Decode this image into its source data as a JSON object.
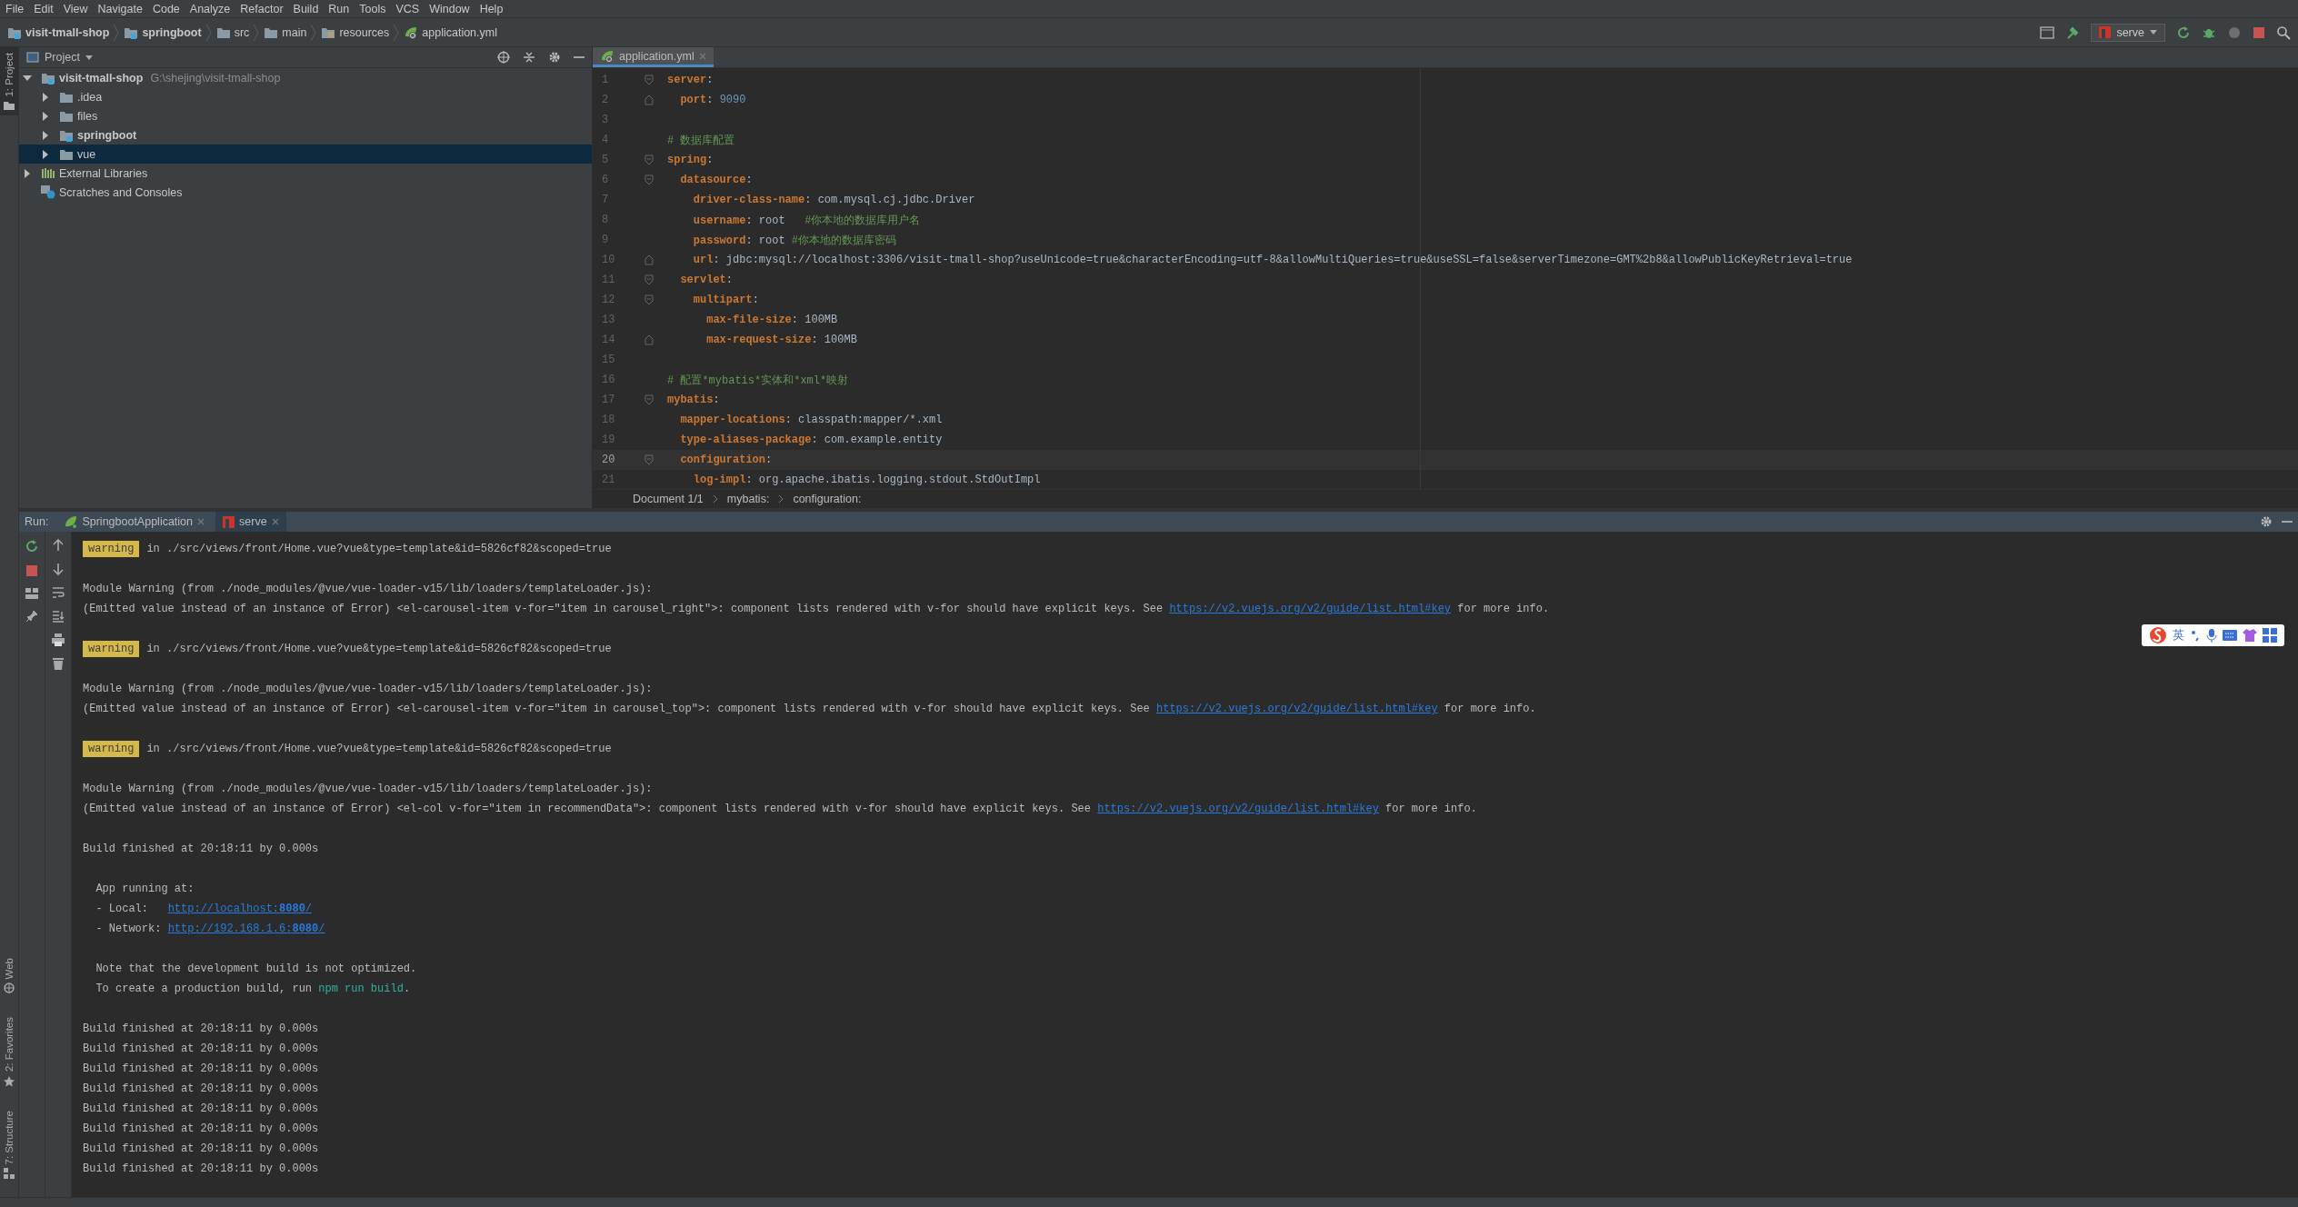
{
  "menu": [
    "File",
    "Edit",
    "View",
    "Navigate",
    "Code",
    "Analyze",
    "Refactor",
    "Build",
    "Run",
    "Tools",
    "VCS",
    "Window",
    "Help"
  ],
  "breadcrumbs": [
    {
      "label": "visit-tmall-shop",
      "kind": "module"
    },
    {
      "label": "springboot",
      "kind": "module"
    },
    {
      "label": "src",
      "kind": "folder"
    },
    {
      "label": "main",
      "kind": "folder"
    },
    {
      "label": "resources",
      "kind": "resources"
    },
    {
      "label": "application.yml",
      "kind": "file"
    }
  ],
  "run_config": {
    "label": "serve"
  },
  "side_tabs_top": [
    {
      "label": "1: Project",
      "selected": true
    }
  ],
  "side_tabs_bottom": [
    {
      "label": "Web",
      "kind": "web",
      "selected": false
    },
    {
      "label": "2: Favorites",
      "kind": "favorites",
      "selected": false
    },
    {
      "label": "7: Structure",
      "kind": "structure",
      "selected": false
    }
  ],
  "project": {
    "title": "Project",
    "tree": [
      {
        "label": "visit-tmall-shop",
        "kind": "module",
        "path": "G:\\shejing\\visit-tmall-shop",
        "expanded": true,
        "selected": false,
        "children": [
          {
            "label": ".idea",
            "kind": "folder",
            "expanded": false,
            "selected": false
          },
          {
            "label": "files",
            "kind": "folder",
            "expanded": false,
            "selected": false
          },
          {
            "label": "springboot",
            "kind": "module",
            "expanded": false,
            "selected": false
          },
          {
            "label": "vue",
            "kind": "folder",
            "expanded": false,
            "selected": true
          }
        ]
      },
      {
        "label": "External Libraries",
        "kind": "libraries",
        "expanded": false,
        "selected": false
      },
      {
        "label": "Scratches and Consoles",
        "kind": "scratches",
        "selected": false
      }
    ]
  },
  "editor": {
    "tabs": [
      {
        "label": "application.yml",
        "selected": true
      }
    ],
    "lines": [
      {
        "number": "1",
        "fold": {
          "kind": "start"
        },
        "current": false,
        "tokens": [
          {
            "kind": "key",
            "text": "server"
          },
          {
            "kind": "punct",
            "text": ":"
          }
        ]
      },
      {
        "number": "2",
        "fold": {
          "kind": "end"
        },
        "current": false,
        "tokens": [
          {
            "kind": "key",
            "text": "  port"
          },
          {
            "kind": "punct",
            "text": ": "
          },
          {
            "kind": "number",
            "text": "9090"
          }
        ]
      },
      {
        "number": "3",
        "current": false
      },
      {
        "number": "4",
        "current": false,
        "tokens": [
          {
            "kind": "comment",
            "text": "# 数据库配置"
          }
        ]
      },
      {
        "number": "5",
        "fold": {
          "kind": "start"
        },
        "current": false,
        "tokens": [
          {
            "kind": "key",
            "text": "spring"
          },
          {
            "kind": "punct",
            "text": ":"
          }
        ]
      },
      {
        "number": "6",
        "fold": {
          "kind": "start"
        },
        "current": false,
        "tokens": [
          {
            "kind": "key",
            "text": "  datasource"
          },
          {
            "kind": "punct",
            "text": ":"
          }
        ]
      },
      {
        "number": "7",
        "current": false,
        "tokens": [
          {
            "kind": "key",
            "text": "    driver-class-name"
          },
          {
            "kind": "punct",
            "text": ": "
          },
          {
            "kind": "value",
            "text": "com.mysql.cj.jdbc.Driver"
          }
        ]
      },
      {
        "number": "8",
        "current": false,
        "tokens": [
          {
            "kind": "key",
            "text": "    username"
          },
          {
            "kind": "punct",
            "text": ": "
          },
          {
            "kind": "value",
            "text": "root   "
          },
          {
            "kind": "comment",
            "text": "#你本地的数据库用户名"
          }
        ]
      },
      {
        "number": "9",
        "current": false,
        "tokens": [
          {
            "kind": "key",
            "text": "    password"
          },
          {
            "kind": "punct",
            "text": ": "
          },
          {
            "kind": "value",
            "text": "root "
          },
          {
            "kind": "comment",
            "text": "#你本地的数据库密码"
          }
        ]
      },
      {
        "number": "10",
        "fold": {
          "kind": "end"
        },
        "current": false,
        "tokens": [
          {
            "kind": "key",
            "text": "    url"
          },
          {
            "kind": "punct",
            "text": ": "
          },
          {
            "kind": "value",
            "text": "jdbc:mysql://localhost:3306/visit-tmall-shop?useUnicode=true&characterEncoding=utf-8&allowMultiQueries=true&useSSL=false&serverTimezone=GMT%2b8&allowPublicKeyRetrieval=true"
          }
        ]
      },
      {
        "number": "11",
        "fold": {
          "kind": "start"
        },
        "current": false,
        "tokens": [
          {
            "kind": "key",
            "text": "  servlet"
          },
          {
            "kind": "punct",
            "text": ":"
          }
        ]
      },
      {
        "number": "12",
        "fold": {
          "kind": "start"
        },
        "current": false,
        "tokens": [
          {
            "kind": "key",
            "text": "    multipart"
          },
          {
            "kind": "punct",
            "text": ":"
          }
        ]
      },
      {
        "number": "13",
        "current": false,
        "tokens": [
          {
            "kind": "key",
            "text": "      max-file-size"
          },
          {
            "kind": "punct",
            "text": ": "
          },
          {
            "kind": "value",
            "text": "100MB"
          }
        ]
      },
      {
        "number": "14",
        "fold": {
          "kind": "end"
        },
        "current": false,
        "tokens": [
          {
            "kind": "key",
            "text": "      max-request-size"
          },
          {
            "kind": "punct",
            "text": ": "
          },
          {
            "kind": "value",
            "text": "100MB"
          }
        ]
      },
      {
        "number": "15",
        "current": false
      },
      {
        "number": "16",
        "current": false,
        "tokens": [
          {
            "kind": "comment",
            "text": "# 配置*mybatis*实体和*xml*映射"
          }
        ]
      },
      {
        "number": "17",
        "fold": {
          "kind": "start"
        },
        "current": false,
        "tokens": [
          {
            "kind": "key",
            "text": "mybatis"
          },
          {
            "kind": "punct",
            "text": ":"
          }
        ]
      },
      {
        "number": "18",
        "current": false,
        "tokens": [
          {
            "kind": "key",
            "text": "  mapper-locations"
          },
          {
            "kind": "punct",
            "text": ": "
          },
          {
            "kind": "value",
            "text": "classpath:mapper/*.xml"
          }
        ]
      },
      {
        "number": "19",
        "current": false,
        "tokens": [
          {
            "kind": "key",
            "text": "  type-aliases-package"
          },
          {
            "kind": "punct",
            "text": ": "
          },
          {
            "kind": "value",
            "text": "com.example.entity"
          }
        ]
      },
      {
        "number": "20",
        "fold": {
          "kind": "start"
        },
        "current": true,
        "tokens": [
          {
            "kind": "key",
            "text": "  configuration"
          },
          {
            "kind": "punct",
            "text": ":"
          }
        ]
      },
      {
        "number": "21",
        "current": false,
        "tokens": [
          {
            "kind": "key",
            "text": "    log-impl"
          },
          {
            "kind": "punct",
            "text": ": "
          },
          {
            "kind": "value",
            "text": "org.apache.ibatis.logging.stdout.StdOutImpl"
          }
        ]
      }
    ],
    "path": [
      "Document 1/1",
      "mybatis:",
      "configuration:"
    ]
  },
  "run": {
    "label": "Run:",
    "tabs": [
      {
        "label": "SpringbootApplication",
        "kind": "spring",
        "selected": false
      },
      {
        "label": "serve",
        "kind": "npm",
        "selected": true
      }
    ],
    "console": [
      {
        "kind": "warning",
        "badge": "warning",
        "text": "in ./src/views/front/Home.vue?vue&type=template&id=5826cf82&scoped=true"
      },
      {
        "kind": "blank"
      },
      {
        "kind": "text",
        "segments": [
          {
            "kind": "text",
            "text": "Module Warning (from ./node_modules/@vue/vue-loader-v15/lib/loaders/templateLoader.js):"
          }
        ]
      },
      {
        "kind": "text",
        "segments": [
          {
            "kind": "text",
            "text": "(Emitted value instead of an instance of Error) <el-carousel-item v-for=\"item in carousel_right\">: component lists rendered with v-for should have explicit keys. See "
          },
          {
            "kind": "link",
            "text": "https://v2.vuejs.org/v2/guide/list.html#key"
          },
          {
            "kind": "text",
            "text": " for more info."
          }
        ]
      },
      {
        "kind": "blank"
      },
      {
        "kind": "warning",
        "badge": "warning",
        "text": "in ./src/views/front/Home.vue?vue&type=template&id=5826cf82&scoped=true"
      },
      {
        "kind": "blank"
      },
      {
        "kind": "text",
        "segments": [
          {
            "kind": "text",
            "text": "Module Warning (from ./node_modules/@vue/vue-loader-v15/lib/loaders/templateLoader.js):"
          }
        ]
      },
      {
        "kind": "text",
        "segments": [
          {
            "kind": "text",
            "text": "(Emitted value instead of an instance of Error) <el-carousel-item v-for=\"item in carousel_top\">: component lists rendered with v-for should have explicit keys. See "
          },
          {
            "kind": "link",
            "text": "https://v2.vuejs.org/v2/guide/list.html#key"
          },
          {
            "kind": "text",
            "text": " for more info."
          }
        ]
      },
      {
        "kind": "blank"
      },
      {
        "kind": "warning",
        "badge": "warning",
        "text": "in ./src/views/front/Home.vue?vue&type=template&id=5826cf82&scoped=true"
      },
      {
        "kind": "blank"
      },
      {
        "kind": "text",
        "segments": [
          {
            "kind": "text",
            "text": "Module Warning (from ./node_modules/@vue/vue-loader-v15/lib/loaders/templateLoader.js):"
          }
        ]
      },
      {
        "kind": "text",
        "segments": [
          {
            "kind": "text",
            "text": "(Emitted value instead of an instance of Error) <el-col v-for=\"item in recommendData\">: component lists rendered with v-for should have explicit keys. See "
          },
          {
            "kind": "link",
            "text": "https://v2.vuejs.org/v2/guide/list.html#key"
          },
          {
            "kind": "text",
            "text": " for more info."
          }
        ]
      },
      {
        "kind": "blank"
      },
      {
        "kind": "text",
        "segments": [
          {
            "kind": "text",
            "text": "Build finished at 20:18:11 by 0.000s"
          }
        ]
      },
      {
        "kind": "blank"
      },
      {
        "kind": "text",
        "segments": [
          {
            "kind": "text",
            "text": "  App running at:"
          }
        ]
      },
      {
        "kind": "text",
        "segments": [
          {
            "kind": "text",
            "text": "  - Local:   "
          },
          {
            "kind": "link",
            "text": "http://localhost:**8080**/"
          }
        ]
      },
      {
        "kind": "text",
        "segments": [
          {
            "kind": "text",
            "text": "  - Network: "
          },
          {
            "kind": "link",
            "text": "http://192.168.1.6:**8080**/"
          }
        ]
      },
      {
        "kind": "blank"
      },
      {
        "kind": "text",
        "segments": [
          {
            "kind": "text",
            "text": "  Note that the development build is not optimized."
          }
        ]
      },
      {
        "kind": "text",
        "segments": [
          {
            "kind": "text",
            "text": "  To create a production build, run "
          },
          {
            "kind": "command",
            "text": "npm run build"
          },
          {
            "kind": "text",
            "text": "."
          }
        ]
      },
      {
        "kind": "blank"
      },
      {
        "kind": "text",
        "segments": [
          {
            "kind": "text",
            "text": "Build finished at 20:18:11 by 0.000s"
          }
        ]
      },
      {
        "kind": "text",
        "segments": [
          {
            "kind": "text",
            "text": "Build finished at 20:18:11 by 0.000s"
          }
        ]
      },
      {
        "kind": "text",
        "segments": [
          {
            "kind": "text",
            "text": "Build finished at 20:18:11 by 0.000s"
          }
        ]
      },
      {
        "kind": "text",
        "segments": [
          {
            "kind": "text",
            "text": "Build finished at 20:18:11 by 0.000s"
          }
        ]
      },
      {
        "kind": "text",
        "segments": [
          {
            "kind": "text",
            "text": "Build finished at 20:18:11 by 0.000s"
          }
        ]
      },
      {
        "kind": "text",
        "segments": [
          {
            "kind": "text",
            "text": "Build finished at 20:18:11 by 0.000s"
          }
        ]
      },
      {
        "kind": "text",
        "segments": [
          {
            "kind": "text",
            "text": "Build finished at 20:18:11 by 0.000s"
          }
        ]
      },
      {
        "kind": "text",
        "segments": [
          {
            "kind": "text",
            "text": "Build finished at 20:18:11 by 0.000s"
          }
        ]
      }
    ]
  },
  "ime": {
    "label": "英"
  }
}
